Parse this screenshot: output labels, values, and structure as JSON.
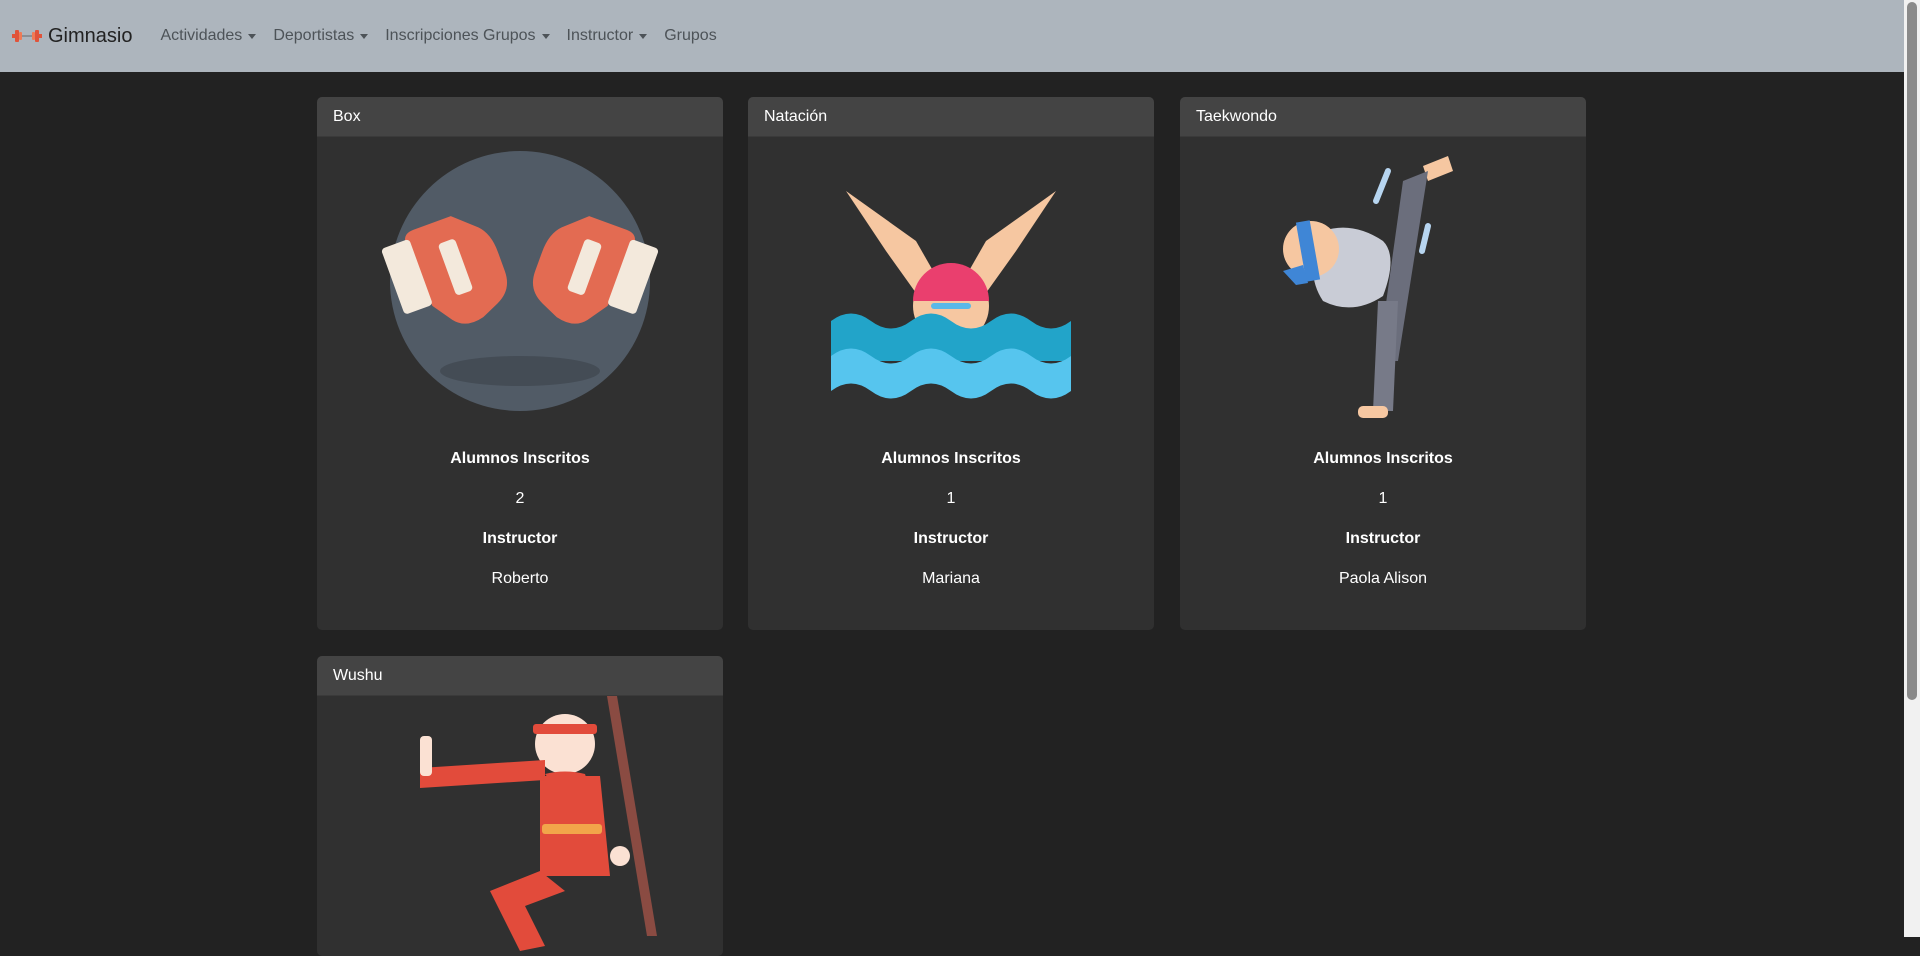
{
  "navbar": {
    "brand": "Gimnasio",
    "items": [
      {
        "label": "Actividades",
        "dropdown": true
      },
      {
        "label": "Deportistas",
        "dropdown": true
      },
      {
        "label": "Inscripciones Grupos",
        "dropdown": true
      },
      {
        "label": "Instructor",
        "dropdown": true
      },
      {
        "label": "Grupos",
        "dropdown": false
      }
    ]
  },
  "cards": [
    {
      "title": "Box",
      "icon": "boxing-gloves-icon",
      "enrolled_label": "Alumnos Inscritos",
      "enrolled": "2",
      "instructor_label": "Instructor",
      "instructor": "Roberto"
    },
    {
      "title": "Natación",
      "icon": "swimmer-icon",
      "enrolled_label": "Alumnos Inscritos",
      "enrolled": "1",
      "instructor_label": "Instructor",
      "instructor": "Mariana"
    },
    {
      "title": "Taekwondo",
      "icon": "taekwondo-kick-icon",
      "enrolled_label": "Alumnos Inscritos",
      "enrolled": "1",
      "instructor_label": "Instructor",
      "instructor": "Paola Alison"
    },
    {
      "title": "Wushu",
      "icon": "wushu-fighter-icon"
    }
  ],
  "colors": {
    "navbar_bg": "#adb5bd",
    "page_bg": "#222222",
    "card_bg": "#303030",
    "card_header_bg": "#444444"
  }
}
